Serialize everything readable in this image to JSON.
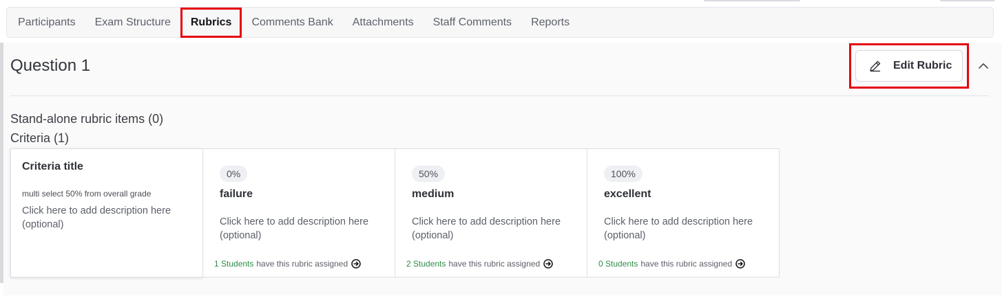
{
  "tabs": [
    {
      "label": "Participants"
    },
    {
      "label": "Exam Structure"
    },
    {
      "label": "Rubrics",
      "active": true
    },
    {
      "label": "Comments Bank"
    },
    {
      "label": "Attachments"
    },
    {
      "label": "Staff Comments"
    },
    {
      "label": "Reports"
    }
  ],
  "question": {
    "title": "Question 1",
    "edit_label": "Edit Rubric",
    "edit_icon": "pencil-icon",
    "collapse_icon": "chevron-up-icon"
  },
  "standalone_label": "Stand-alone rubric items (0)",
  "criteria_label": "Criteria (1)",
  "criteria": {
    "title": "Criteria title",
    "subtitle": "multi select 50% from overall grade",
    "description": "Click here to add description here (optional)"
  },
  "levels": [
    {
      "percent": "0%",
      "name": "failure",
      "description": "Click here to add description here (optional)",
      "students": "1 Students",
      "assigned_text": "have this rubric assigned"
    },
    {
      "percent": "50%",
      "name": "medium",
      "description": "Click here to add description here (optional)",
      "students": "2 Students",
      "assigned_text": "have this rubric assigned"
    },
    {
      "percent": "100%",
      "name": "excellent",
      "description": "Click here to add description here (optional)",
      "students": "0 Students",
      "assigned_text": "have this rubric assigned"
    }
  ],
  "colors": {
    "highlight": "#e5000a",
    "students_link": "#2e8b4a"
  }
}
